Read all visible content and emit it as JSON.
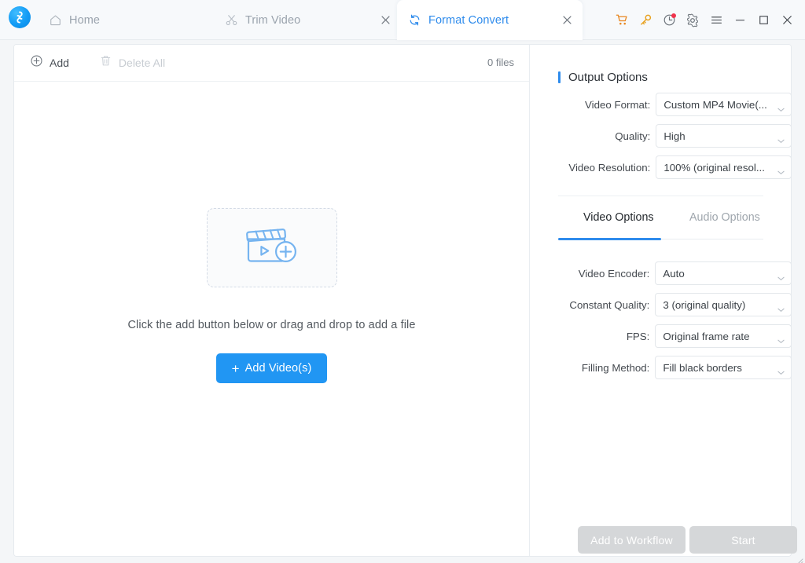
{
  "window": {
    "controls": [
      {
        "name": "cart-icon",
        "label": "Cart"
      },
      {
        "name": "key-icon",
        "label": "Register"
      },
      {
        "name": "history-icon",
        "label": "History"
      },
      {
        "name": "gear-icon",
        "label": "Settings"
      },
      {
        "name": "menu-icon",
        "label": "Menu"
      },
      {
        "name": "minimize-icon",
        "label": "Minimize"
      },
      {
        "name": "maximize-icon",
        "label": "Maximize"
      },
      {
        "name": "close-icon",
        "label": "Close"
      }
    ]
  },
  "tabs": [
    {
      "id": "home",
      "label": "Home",
      "icon": "home-icon",
      "active": false,
      "closable": false
    },
    {
      "id": "trim",
      "label": "Trim Video",
      "icon": "scissors-icon",
      "active": false,
      "closable": true
    },
    {
      "id": "format",
      "label": "Format Convert",
      "icon": "convert-icon",
      "active": true,
      "closable": true
    }
  ],
  "toolbar": {
    "add_label": "Add",
    "delete_all_label": "Delete All",
    "file_count": "0 files"
  },
  "dropzone": {
    "icon": "video-add-icon",
    "hint": "Click the add button below or drag and drop to add a file",
    "button_label": "Add Video(s)",
    "button_plus": "+"
  },
  "output_options": {
    "title": "Output Options",
    "accent_color": "#2e8bec",
    "fields": [
      {
        "label": "Video Format:",
        "value": "Custom MP4 Movie(..."
      },
      {
        "label": "Quality:",
        "value": "High"
      },
      {
        "label": "Video Resolution:",
        "value": "100% (original resol..."
      }
    ]
  },
  "option_tabs": [
    {
      "id": "video",
      "label": "Video Options",
      "active": true
    },
    {
      "id": "audio",
      "label": "Audio Options",
      "active": false
    }
  ],
  "video_options": {
    "fields": [
      {
        "label": "Video Encoder:",
        "value": "Auto"
      },
      {
        "label": "Constant Quality:",
        "value": "3 (original quality)"
      },
      {
        "label": "FPS:",
        "value": "Original frame rate"
      },
      {
        "label": "Filling Method:",
        "value": "Fill black borders"
      }
    ]
  },
  "footer": {
    "add_to_workflow_label": "Add to Workflow",
    "start_label": "Start"
  }
}
